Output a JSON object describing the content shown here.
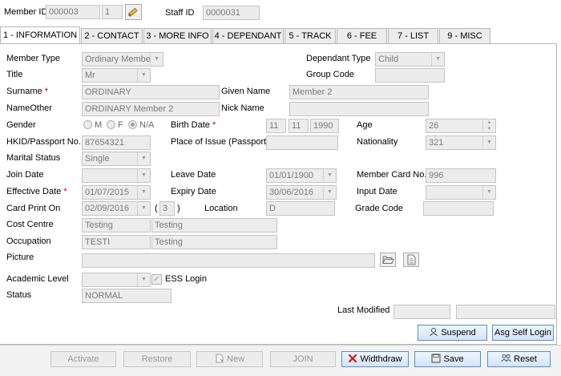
{
  "header": {
    "member_id_label": "Member ID",
    "member_id": "000003",
    "member_id_seq": "1",
    "staff_id_label": "Staff ID",
    "staff_id": "0000031"
  },
  "tabs": [
    {
      "label": "1 - INFORMATION"
    },
    {
      "label": "2 - CONTACT"
    },
    {
      "label": "3 - MORE INFO"
    },
    {
      "label": "4 - DEPENDANT"
    },
    {
      "label": "5 - TRACK"
    },
    {
      "label": "6 - FEE"
    },
    {
      "label": "7 - LIST"
    },
    {
      "label": "9 - MISC"
    }
  ],
  "form": {
    "member_type_label": "Member Type",
    "member_type": "Ordinary Member",
    "dependant_type_label": "Dependant Type",
    "dependant_type": "Child",
    "title_label": "Title",
    "title": "Mr",
    "group_code_label": "Group Code",
    "group_code": "",
    "surname_label": "Surname",
    "surname": "ORDINARY",
    "given_name_label": "Given Name",
    "given_name": "Member 2",
    "name_other_label": "NameOther",
    "name_other": "ORDINARY Member 2",
    "nick_name_label": "Nick Name",
    "nick_name": "",
    "gender_label": "Gender",
    "gender_m": "M",
    "gender_f": "F",
    "gender_na": "N/A",
    "birth_date_label": "Birth Date",
    "birth_day": "11",
    "birth_month": "11",
    "birth_year": "1990",
    "age_label": "Age",
    "age": "26",
    "hkid_label": "HKID/Passport No.",
    "hkid": "87654321",
    "place_issue_label": "Place of Issue (Passport)",
    "place_issue": "",
    "nationality_label": "Nationality",
    "nationality": "321",
    "marital_label": "Marital Status",
    "marital": "Single",
    "join_date_label": "Join Date",
    "join_date": "",
    "leave_date_label": "Leave Date",
    "leave_date": "01/01/1900",
    "member_card_label": "Member Card No.",
    "member_card": "996",
    "effective_label": "Effective Date",
    "effective": "01/07/2015",
    "expiry_label": "Expiry Date",
    "expiry": "30/06/2016",
    "input_date_label": "Input Date",
    "input_date": "",
    "card_print_label": "Card Print On",
    "card_print": "02/09/2016",
    "card_print_count": "3",
    "paren_open": "(",
    "paren_close": ")",
    "location_label": "Location",
    "location": "D",
    "grade_code_label": "Grade Code",
    "grade_code": "",
    "cost_centre_label": "Cost Centre",
    "cost_centre_code": "Testing",
    "cost_centre_name": "Testing",
    "occupation_label": "Occupation",
    "occupation_code": "TESTI",
    "occupation_name": "Testing",
    "picture_label": "Picture",
    "picture": "",
    "academic_label": "Academic Level",
    "academic": "",
    "ess_login_label": "ESS Login",
    "status_label": "Status",
    "status": "NORMAL",
    "last_modified_label": "Last Modified",
    "last_modified_by": "",
    "last_modified_on": ""
  },
  "panel_buttons": {
    "suspend": "Suspend",
    "asg_self_login": "Asg Self Login"
  },
  "toolbar": {
    "activate": "Activate",
    "restore": "Restore",
    "new": "New",
    "join": "JOIN",
    "withdraw": "Widthdraw",
    "save": "Save",
    "reset": "Reset"
  },
  "colors": {
    "required": "#cc0000",
    "accent_blue": "#5a8fc7",
    "field_bg": "#ececec"
  }
}
